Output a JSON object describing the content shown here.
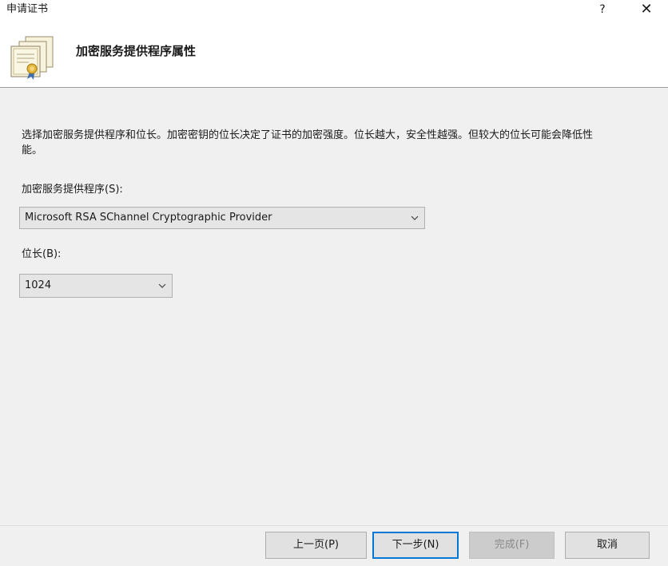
{
  "window": {
    "title": "申请证书",
    "help": "?",
    "close": "✕"
  },
  "header": {
    "title": "加密服务提供程序属性",
    "icon": "certificate-icon"
  },
  "content": {
    "description": "选择加密服务提供程序和位长。加密密钥的位长决定了证书的加密强度。位长越大，安全性越强。但较大的位长可能会降低性能。",
    "csp_label": "加密服务提供程序(S):",
    "csp_value": "Microsoft RSA SChannel Cryptographic Provider",
    "keylen_label": "位长(B):",
    "keylen_value": "1024"
  },
  "buttons": {
    "back": "上一页(P)",
    "next": "下一步(N)",
    "finish": "完成(F)",
    "cancel": "取消"
  },
  "colors": {
    "accent": "#0078d7",
    "background": "#f0f0f0",
    "header_background": "#ffffff"
  }
}
